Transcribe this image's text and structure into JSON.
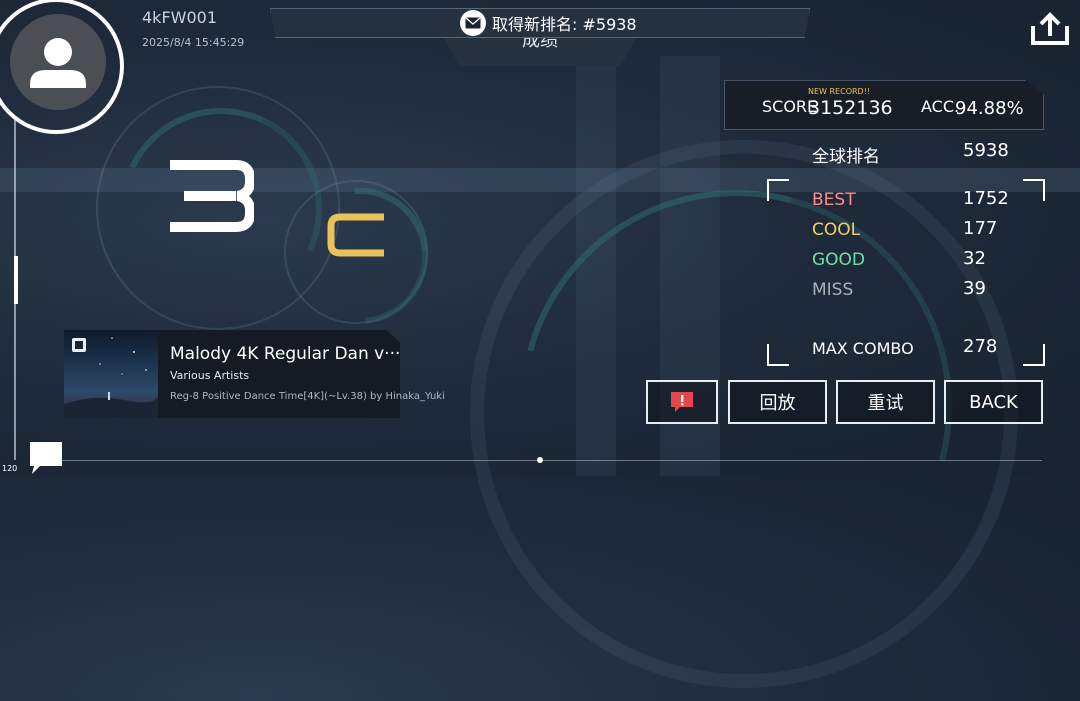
{
  "player": {
    "name": "4kFW001",
    "date": "2025/8/4 15:45:29"
  },
  "header": {
    "notice_text": "取得新排名: #5938",
    "title": "成绩"
  },
  "result": {
    "rank_main": "3",
    "rank_sub": "C"
  },
  "song": {
    "title": "Malody 4K Regular Dan v···",
    "artist": "Various Artists",
    "chart_info": "Reg-8 Positive Dance Time[4K](~Lv.38) by Hinaka_Yuki"
  },
  "score_panel": {
    "new_record": "NEW RECORD!!",
    "score_label": "SCORE",
    "score_value": "3152136",
    "acc_label": "ACC.",
    "acc_value": "94.88%"
  },
  "stats": {
    "global_rank_label": "全球排名",
    "global_rank_value": "5938",
    "judgements": [
      {
        "label": "BEST",
        "value": "1752",
        "color": "#ff8a8a"
      },
      {
        "label": "COOL",
        "value": "177",
        "color": "#f2cf63"
      },
      {
        "label": "GOOD",
        "value": "32",
        "color": "#6ee0a8"
      },
      {
        "label": "MISS",
        "value": "39",
        "color": "#a9b0b8"
      }
    ],
    "max_combo_label": "MAX COMBO",
    "max_combo_value": "278"
  },
  "buttons": {
    "replay": "回放",
    "retry": "重试",
    "back": "BACK"
  },
  "footer": {
    "fps": "120"
  },
  "colors": {
    "rank_sub": "#e9c35a",
    "report": "#e2474b"
  }
}
